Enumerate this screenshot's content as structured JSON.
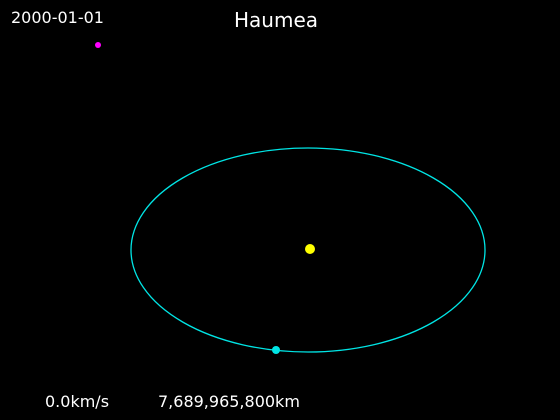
{
  "date": "2000-01-01",
  "title": "Haumea",
  "speed": "0.0km/s",
  "distance": "7,689,965,800km",
  "colors": {
    "background": "#000000",
    "text": "#ffffff",
    "orbit": "#00e5e5",
    "sun": "#ffff00",
    "body": "#00e5e5",
    "reference_dot": "#ff00ff"
  }
}
